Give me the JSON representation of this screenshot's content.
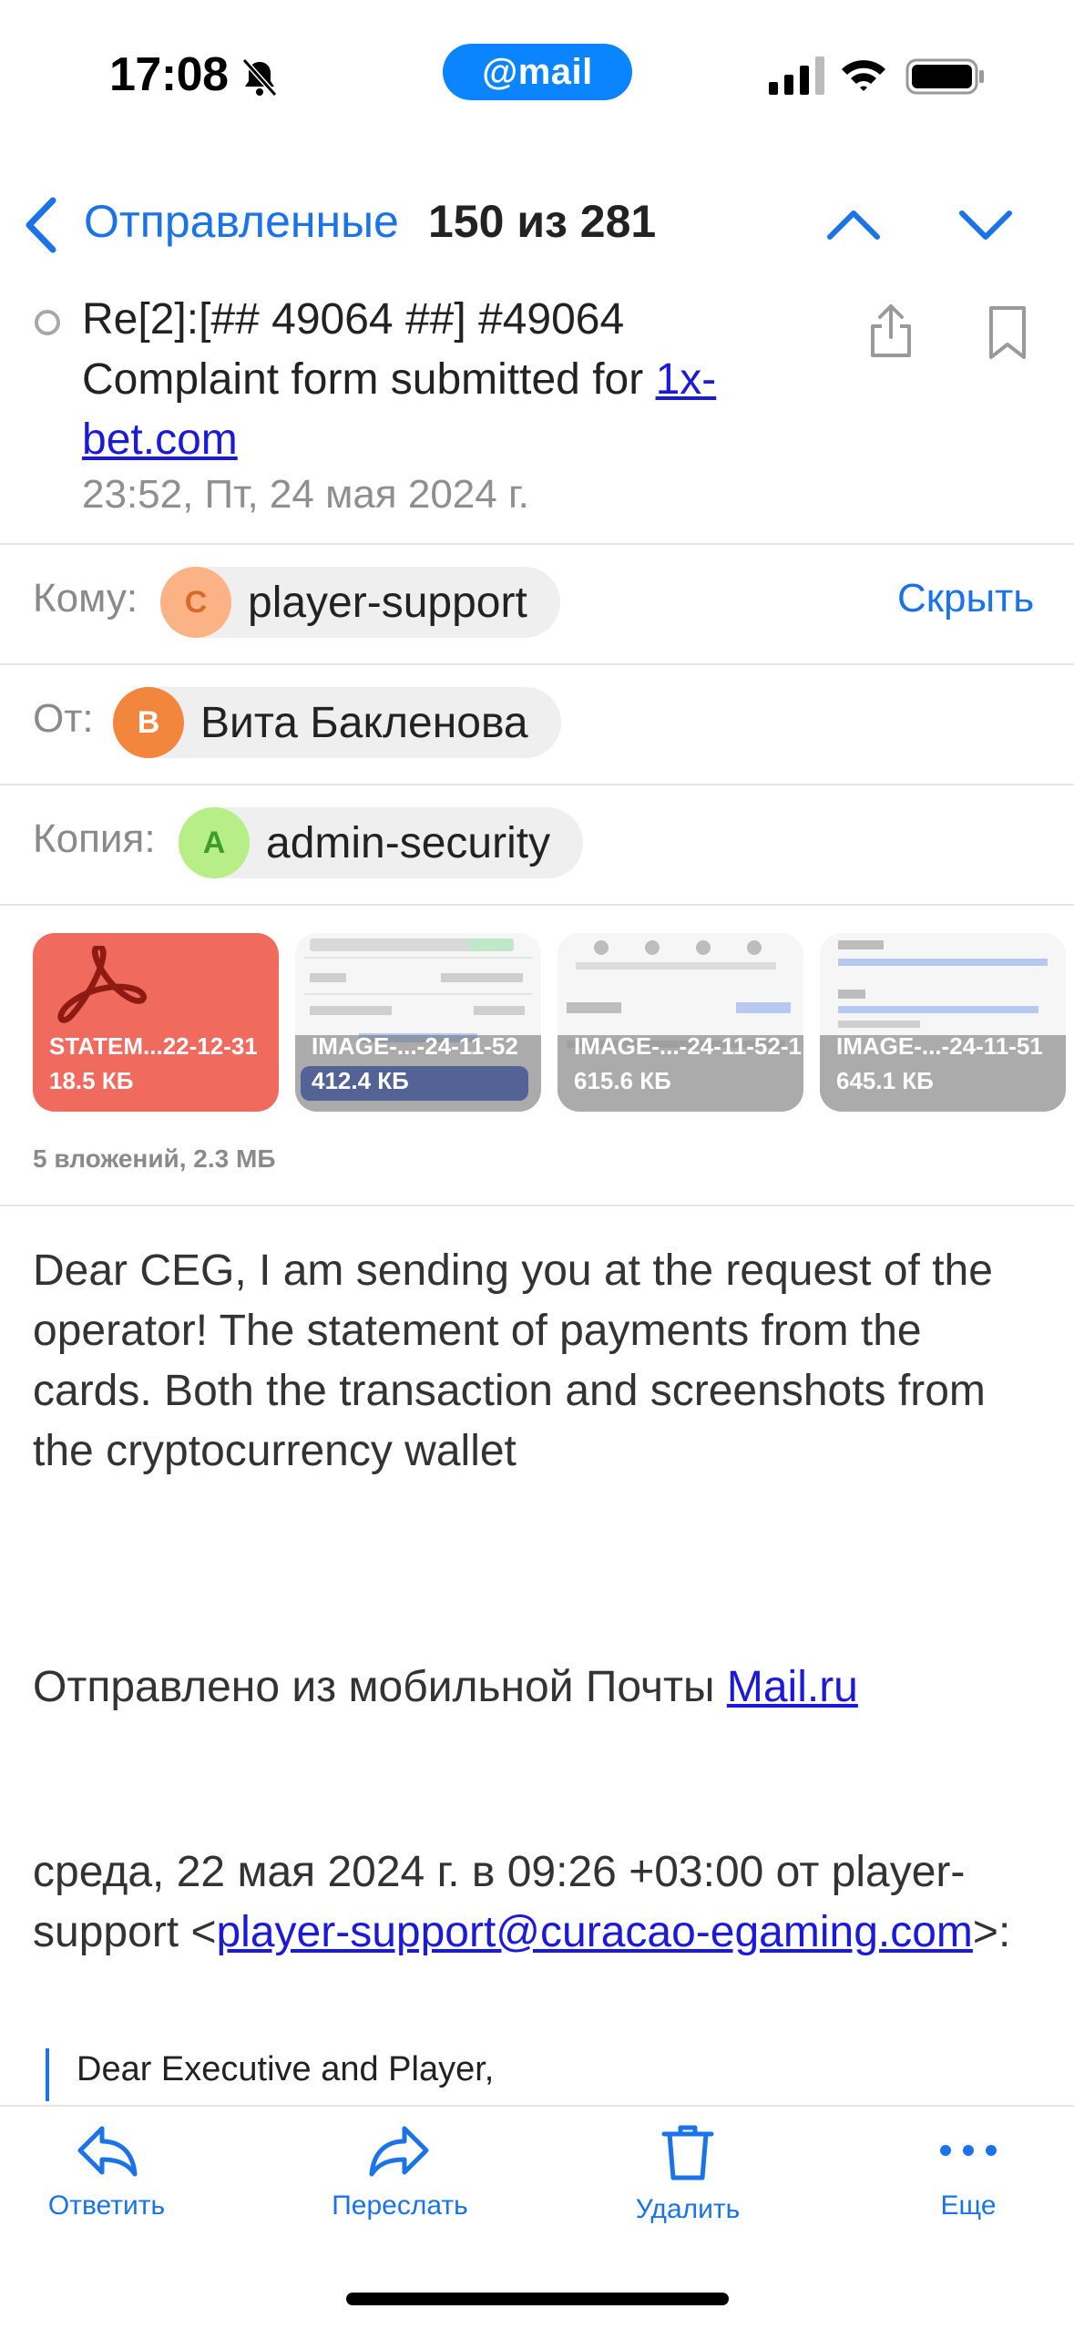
{
  "status_bar": {
    "time": "17:08",
    "app_pill": "@mail"
  },
  "nav": {
    "back_label": "Отправленные",
    "counter": "150 из 281"
  },
  "message": {
    "subject_line1": "Re[2]:[## 49064 ##] #49064",
    "subject_line2_prefix": "Complaint form submitted for ",
    "subject_link": "1x-bet.com",
    "date": "23:52, Пт, 24 мая 2024 г."
  },
  "recipients": {
    "to_label": "Кому:",
    "to_initial": "C",
    "to_name": "player-support",
    "hide_label": "Скрыть",
    "from_label": "От:",
    "from_initial": "В",
    "from_name": "Вита Бакленова",
    "cc_label": "Копия:",
    "cc_initial": "A",
    "cc_name": "admin-security"
  },
  "attachments": {
    "items": [
      {
        "name": "STATEM...22-12-31",
        "size": "18.5 КБ"
      },
      {
        "name": "IMAGE-...-24-11-52",
        "size": "412.4 КБ"
      },
      {
        "name": "IMAGE-...-24-11-52-1",
        "size": "615.6 КБ"
      },
      {
        "name": "IMAGE-...-24-11-51",
        "size": "645.1 КБ"
      }
    ],
    "summary": "5 вложений, 2.3 МБ"
  },
  "body": {
    "text": "Dear CEG, I am sending you at the request of the operator! The statement of payments from the cards. Both the transaction and screenshots from the cryptocurrency wallet",
    "sent_from_prefix": "Отправлено из мобильной Почты ",
    "sent_from_link": "Mail.ru",
    "quote_head_prefix": "среда, 22 мая 2024 г. в 09:26 +03:00 от player-support <",
    "quote_head_link": "player-support@curacao-egaming.com",
    "quote_head_suffix": ">:",
    "quote_first_line": "Dear Executive and Player,"
  },
  "toolbar": {
    "reply": "Ответить",
    "forward": "Переслать",
    "delete": "Удалить",
    "more": "Еще"
  },
  "colors": {
    "accent": "#1a73e8",
    "pdf_tile": "#f06a5e",
    "pill": "#0a84ff"
  }
}
